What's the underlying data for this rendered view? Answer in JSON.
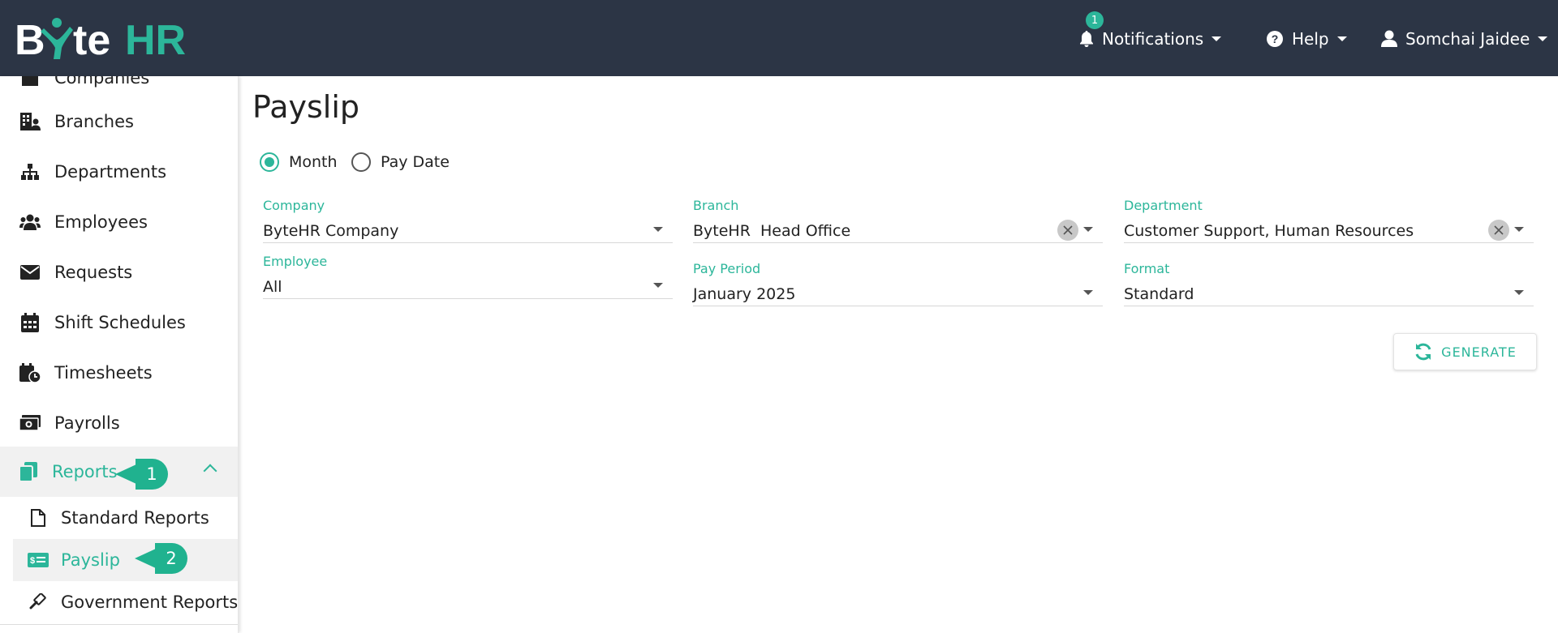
{
  "header": {
    "logo": "ByteHR",
    "notifications": {
      "label": "Notifications",
      "count": "1"
    },
    "help_label": "Help",
    "user_label": "Somchai Jaidee"
  },
  "sidebar": {
    "items": [
      {
        "label": "Companies",
        "icon": "companies-icon"
      },
      {
        "label": "Branches",
        "icon": "branches-icon"
      },
      {
        "label": "Departments",
        "icon": "departments-icon"
      },
      {
        "label": "Employees",
        "icon": "employees-icon"
      },
      {
        "label": "Requests",
        "icon": "envelope-icon"
      },
      {
        "label": "Shift Schedules",
        "icon": "calendar-icon"
      },
      {
        "label": "Timesheets",
        "icon": "timesheet-icon"
      },
      {
        "label": "Payrolls",
        "icon": "money-icon"
      },
      {
        "label": "Reports",
        "icon": "reports-icon",
        "expanded": true
      }
    ],
    "subitems": [
      {
        "label": "Standard Reports",
        "icon": "file-icon"
      },
      {
        "label": "Payslip",
        "icon": "payslip-icon",
        "active": true
      },
      {
        "label": "Government Reports",
        "icon": "gavel-icon"
      }
    ],
    "callouts": [
      "1",
      "2"
    ]
  },
  "main": {
    "title": "Payslip",
    "radio": {
      "month": "Month",
      "pay_date": "Pay Date",
      "selected": "Month"
    },
    "fields": {
      "company": {
        "label": "Company",
        "value": "ByteHR Company"
      },
      "branch": {
        "label": "Branch",
        "value": "ByteHR  Head Office"
      },
      "department": {
        "label": "Department",
        "value": "Customer Support, Human Resources"
      },
      "employee": {
        "label": "Employee",
        "value": "All"
      },
      "pay_period": {
        "label": "Pay Period",
        "value": "January 2025"
      },
      "format": {
        "label": "Format",
        "value": "Standard"
      }
    },
    "generate_label": "GENERATE"
  },
  "colors": {
    "accent": "#2cb69a",
    "topbar": "#2c3545"
  }
}
